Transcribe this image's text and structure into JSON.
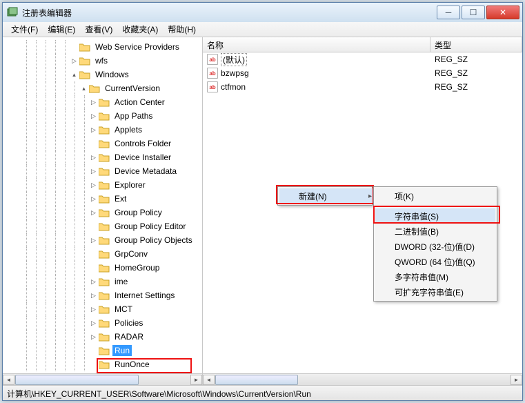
{
  "window": {
    "title": "注册表编辑器"
  },
  "menu": {
    "file": "文件(F)",
    "edit": "编辑(E)",
    "view": "查看(V)",
    "favorites": "收藏夹(A)",
    "help": "帮助(H)"
  },
  "tree": {
    "items": [
      {
        "depth": 3,
        "exp": "",
        "label": "Web Service Providers"
      },
      {
        "depth": 3,
        "exp": "▷",
        "label": "wfs"
      },
      {
        "depth": 3,
        "exp": "▴",
        "label": "Windows"
      },
      {
        "depth": 4,
        "exp": "▴",
        "label": "CurrentVersion"
      },
      {
        "depth": 5,
        "exp": "▷",
        "label": "Action Center"
      },
      {
        "depth": 5,
        "exp": "▷",
        "label": "App Paths"
      },
      {
        "depth": 5,
        "exp": "▷",
        "label": "Applets"
      },
      {
        "depth": 5,
        "exp": "",
        "label": "Controls Folder"
      },
      {
        "depth": 5,
        "exp": "▷",
        "label": "Device Installer"
      },
      {
        "depth": 5,
        "exp": "▷",
        "label": "Device Metadata"
      },
      {
        "depth": 5,
        "exp": "▷",
        "label": "Explorer"
      },
      {
        "depth": 5,
        "exp": "▷",
        "label": "Ext"
      },
      {
        "depth": 5,
        "exp": "▷",
        "label": "Group Policy"
      },
      {
        "depth": 5,
        "exp": "",
        "label": "Group Policy Editor"
      },
      {
        "depth": 5,
        "exp": "▷",
        "label": "Group Policy Objects"
      },
      {
        "depth": 5,
        "exp": "",
        "label": "GrpConv"
      },
      {
        "depth": 5,
        "exp": "",
        "label": "HomeGroup"
      },
      {
        "depth": 5,
        "exp": "▷",
        "label": "ime"
      },
      {
        "depth": 5,
        "exp": "▷",
        "label": "Internet Settings"
      },
      {
        "depth": 5,
        "exp": "▷",
        "label": "MCT"
      },
      {
        "depth": 5,
        "exp": "▷",
        "label": "Policies"
      },
      {
        "depth": 5,
        "exp": "▷",
        "label": "RADAR"
      },
      {
        "depth": 5,
        "exp": "",
        "label": "Run",
        "selected": true
      },
      {
        "depth": 5,
        "exp": "",
        "label": "RunOnce"
      }
    ]
  },
  "list": {
    "col_name": "名称",
    "col_type": "类型",
    "rows": [
      {
        "name": "(默认)",
        "type": "REG_SZ",
        "selected": true
      },
      {
        "name": "bzwpsg",
        "type": "REG_SZ"
      },
      {
        "name": "ctfmon",
        "type": "REG_SZ"
      }
    ]
  },
  "context": {
    "primary": {
      "new": "新建(N)"
    },
    "submenu": [
      {
        "label": "项(K)"
      },
      {
        "sep": true
      },
      {
        "label": "字符串值(S)",
        "highlight": true
      },
      {
        "label": "二进制值(B)"
      },
      {
        "label": "DWORD (32-位)值(D)"
      },
      {
        "label": "QWORD (64 位)值(Q)"
      },
      {
        "label": "多字符串值(M)"
      },
      {
        "label": "可扩充字符串值(E)"
      }
    ]
  },
  "statusbar": {
    "path": "计算机\\HKEY_CURRENT_USER\\Software\\Microsoft\\Windows\\CurrentVersion\\Run"
  }
}
